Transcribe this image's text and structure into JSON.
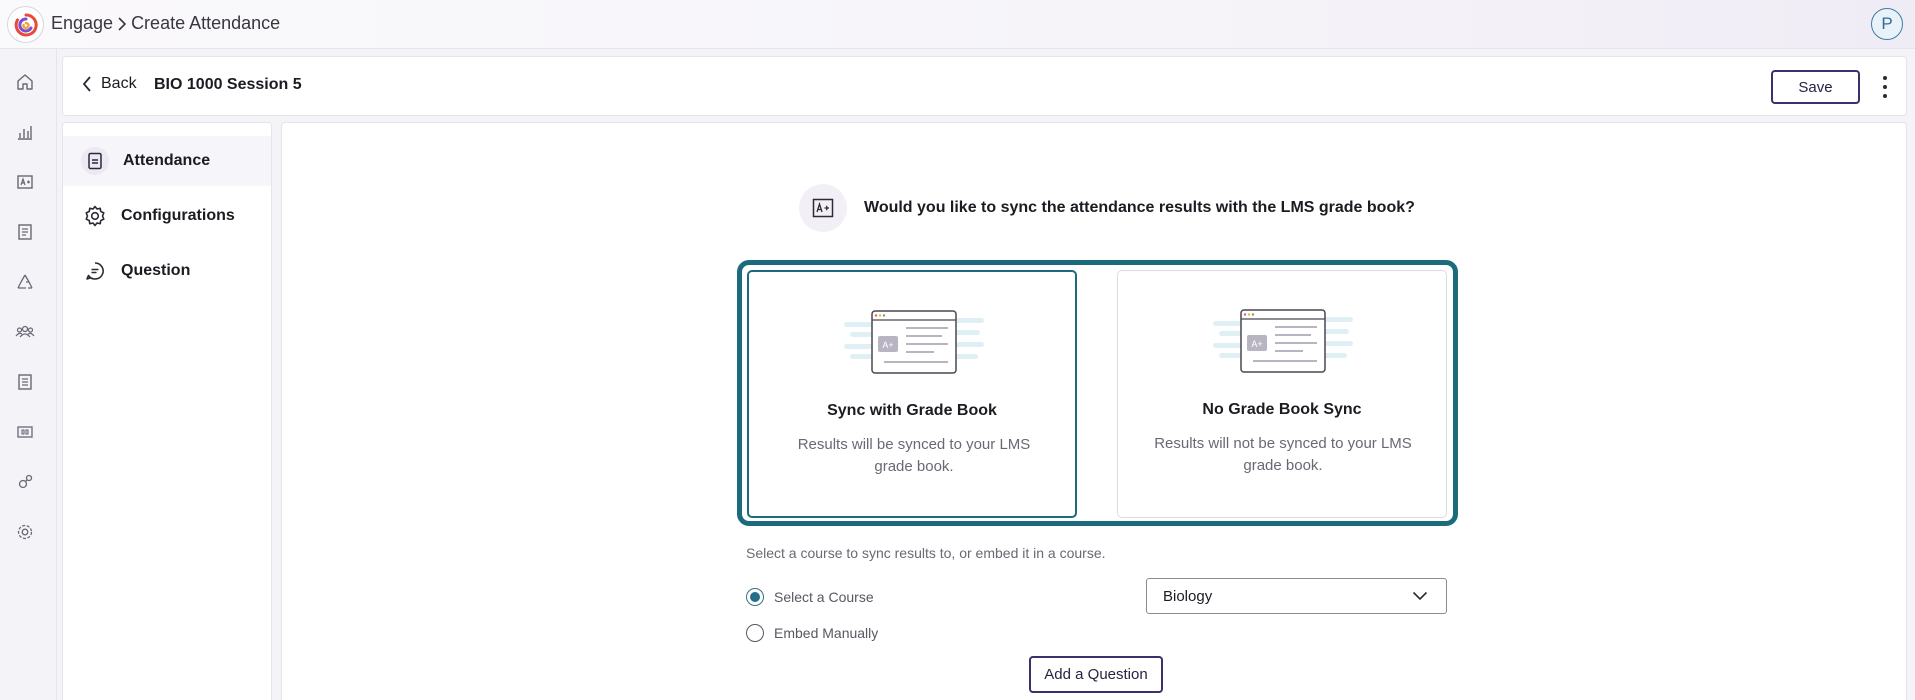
{
  "topbar": {
    "app_name": "Engage",
    "page_title": "Create Attendance",
    "profile_initial": "P"
  },
  "rail": {
    "icons": [
      "home-icon",
      "bar-chart-icon",
      "grade-card-icon",
      "report-icon",
      "recycle-icon",
      "users-icon",
      "list-icon",
      "library-icon",
      "integrations-icon",
      "settings-icon"
    ]
  },
  "header": {
    "back_label": "Back",
    "session_title": "BIO 1000 Session 5",
    "save_label": "Save"
  },
  "sidenav": {
    "items": [
      {
        "label": "Attendance",
        "icon": "document-icon",
        "active": true
      },
      {
        "label": "Configurations",
        "icon": "gear-icon",
        "active": false
      },
      {
        "label": "Question",
        "icon": "chat-bubble-icon",
        "active": false
      }
    ]
  },
  "main": {
    "question": "Would you like to sync the attendance results with the LMS grade book?",
    "options": [
      {
        "title": "Sync with Grade Book",
        "description": "Results will be synced to your LMS grade book.",
        "selected": true
      },
      {
        "title": "No Grade Book Sync",
        "description": "Results will not be synced to your LMS grade book.",
        "selected": false
      }
    ],
    "course_hint": "Select a course to sync results to, or embed it in a course.",
    "radios": [
      {
        "label": "Select a Course",
        "checked": true
      },
      {
        "label": "Embed Manually",
        "checked": false
      }
    ],
    "course_select_value": "Biology",
    "add_question_label": "Add a Question"
  },
  "colors": {
    "accent_teal": "#1b6b7d",
    "button_border": "#3d2f6b"
  }
}
